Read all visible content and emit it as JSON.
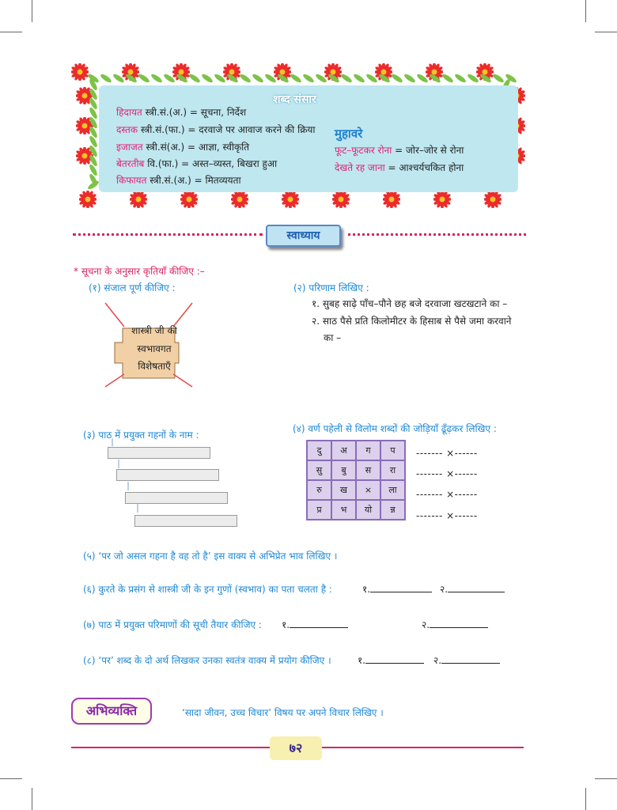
{
  "vocab": {
    "title": "शब्द संसार",
    "entries": [
      {
        "word": "हिदायत",
        "meta": " स्त्री.सं.(अ.) = सूचना, निर्देश"
      },
      {
        "word": "दस्तक",
        "meta": " स्त्री.सं.(फा.) = दरवाजे पर आवाज करने की क्रिया"
      },
      {
        "word": "इजाजत",
        "meta": " स्त्री.सं(अ.) = आज्ञा, स्वीकृति"
      },
      {
        "word": "बेतरतीब",
        "meta": " वि.(फा.) = अस्त–व्यस्त, बिखरा हुआ"
      },
      {
        "word": "किफायत",
        "meta": " स्त्री.सं.(अ.) = मितव्ययता"
      }
    ],
    "idioms_title": "मुहावरे",
    "idioms": [
      {
        "word": "फूट–फूटकर रोना",
        "meta": " = जोर–जोर से रोना"
      },
      {
        "word": "देखते रह जाना",
        "meta": " = आश्चर्यचकित होना"
      }
    ]
  },
  "section": {
    "banner": "स्वाध्याय",
    "instruction": "* सूचना के अनुसार कृतियाँ कीजिए :–"
  },
  "q1": {
    "label": "(१) संजाल पूर्ण कीजिए :",
    "center_lines": [
      "शास्त्री जी की",
      "स्वभावगत",
      "विशेषताएँ"
    ]
  },
  "q2": {
    "label": "(२) परिणाम लिखिए :",
    "items": [
      "१. सुबह साढ़े पाँच–पौने छह बजे दरवाजा खटखटाने का –",
      "२. साठ पैसे प्रति किलोमीटर के हिसाब से पैसे जमा करवाने",
      "का –"
    ]
  },
  "q3": {
    "label": "(३) पाठ में प्रयुक्त गहनों के नाम :"
  },
  "q4": {
    "label": "(४) वर्ण पहेली से विलोम शब्दों की जोड़ियाँ ढूँढ़कर लिखिए :",
    "grid": [
      [
        "दु",
        "अ",
        "ग",
        "प"
      ],
      [
        "सु",
        "बु",
        "स",
        "रा"
      ],
      [
        "रु",
        "ख",
        "×",
        "ला"
      ],
      [
        "प्र",
        "भ",
        "यो",
        "न्न"
      ]
    ],
    "pair_text": "------- ×------"
  },
  "q5": {
    "label": "(५) ‘पर जो असल गहना है वह तो है’  इस वाक्य से अभिप्रेत भाव लिखिए ।"
  },
  "q6": {
    "label": "(६) कुरते के प्रसंग से शास्त्री जी के इन गुणों (स्वभाव) का पता चलता है :",
    "n1": "१.",
    "n2": "२."
  },
  "q7": {
    "label": "(७) पाठ में प्रयुक्त परिमाणों की सूची तैयार कीजिए :",
    "n1": "१.",
    "n2": "२."
  },
  "q8": {
    "label": "(८) ‘पर’ शब्द के दो अर्थ लिखकर उनका स्वतंत्र वाक्य में प्रयोग कीजिए ।",
    "n1": "१.",
    "n2": "२."
  },
  "expression": {
    "tag": "अभिव्यक्ति",
    "text": "‘सादा जीवन, उच्च विचार’ विषय पर अपने विचार लिखिए ।"
  },
  "page_number": "७२",
  "colors": {
    "accent_pink": "#d8245e",
    "accent_blue": "#1e88d6",
    "panel": "#bfe7f0",
    "grid": "#dcd0ec"
  }
}
